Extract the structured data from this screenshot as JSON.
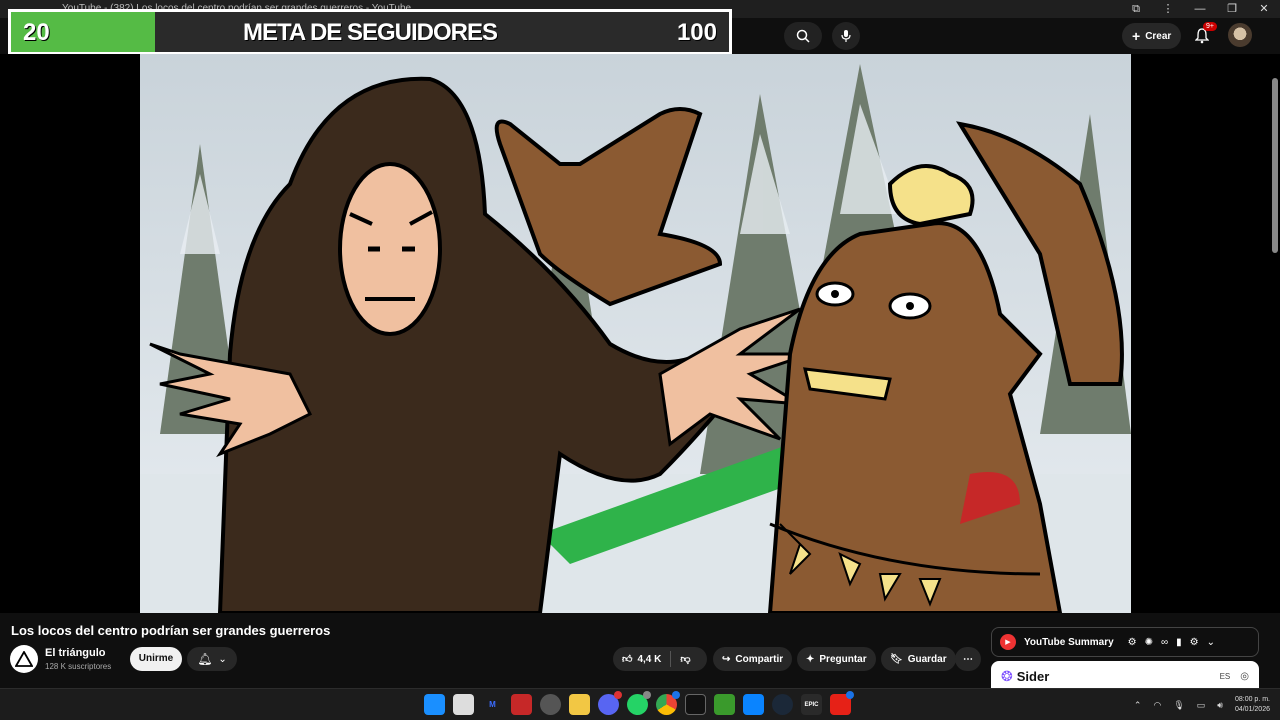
{
  "browser": {
    "tab_title": "YouTube - (382) Los locos del centro podrían ser grandes guerreros - YouTube",
    "window_controls": [
      "—",
      "❐",
      "✕"
    ]
  },
  "header": {
    "create_label": "Crear",
    "notification_count": "9+"
  },
  "overlay": {
    "current": "20",
    "label": "META DE SEGUIDORES",
    "goal": "100",
    "progress_fraction": 0.2,
    "fill_color": "#55bb45"
  },
  "video": {
    "title": "Los locos del centro podrían ser grandes guerreros"
  },
  "channel": {
    "name": "El triángulo",
    "subscribers": "128 K suscriptores",
    "join_label": "Unirme"
  },
  "actions": {
    "likes": "4,4 K",
    "share": "Compartir",
    "ask": "Preguntar",
    "save": "Guardar"
  },
  "extensions": {
    "summary_title": "YouTube Summary",
    "sider_name": "Sider",
    "sider_lang": "ES"
  },
  "taskbar": {
    "time": "08:00 p. m.",
    "date": "04/01/2026",
    "icons": [
      "windows-icon",
      "task-view-icon",
      "mail-icon",
      "app-icon",
      "chrome-icon",
      "file-explorer-icon",
      "discord-icon",
      "whatsapp-icon",
      "chrome-profile-icon",
      "capcut-icon",
      "minecraft-icon",
      "store-icon",
      "steam-icon",
      "epic-games-icon",
      "youtube-icon"
    ]
  }
}
